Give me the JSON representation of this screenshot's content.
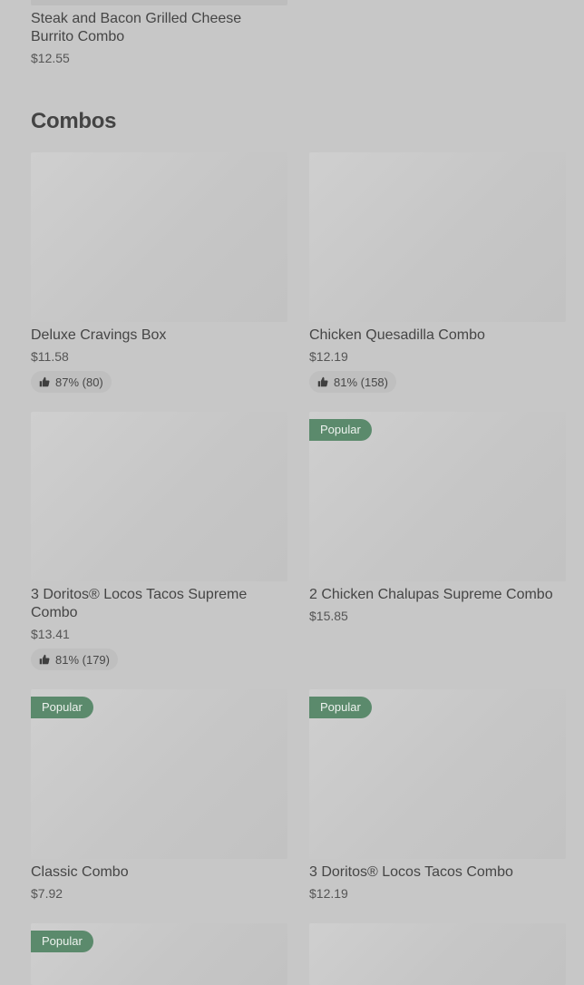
{
  "top_item": {
    "name": "Steak and Bacon Grilled Cheese Burrito Combo",
    "price": "$12.55"
  },
  "section": {
    "title": "Combos"
  },
  "items": [
    {
      "name": "Deluxe Cravings Box",
      "price": "$11.58",
      "rating": "87% (80)",
      "badge": ""
    },
    {
      "name": "Chicken Quesadilla Combo",
      "price": "$12.19",
      "rating": "81% (158)",
      "badge": ""
    },
    {
      "name": "3 Doritos® Locos Tacos Supreme Combo",
      "price": "$13.41",
      "rating": "81% (179)",
      "badge": ""
    },
    {
      "name": "2 Chicken Chalupas Supreme Combo",
      "price": "$15.85",
      "rating": "",
      "badge": "Popular"
    },
    {
      "name": "Classic Combo",
      "price": "$7.92",
      "rating": "",
      "badge": "Popular"
    },
    {
      "name": "3 Doritos® Locos Tacos Combo",
      "price": "$12.19",
      "rating": "",
      "badge": "Popular"
    },
    {
      "name": "",
      "price": "",
      "rating": "",
      "badge": "Popular"
    },
    {
      "name": "",
      "price": "",
      "rating": "",
      "badge": ""
    }
  ],
  "colors": {
    "badge_bg": "#5b8a6c",
    "page_bg": "#c7c7c7"
  },
  "icons": {
    "rating": "thumbs-up-icon"
  }
}
